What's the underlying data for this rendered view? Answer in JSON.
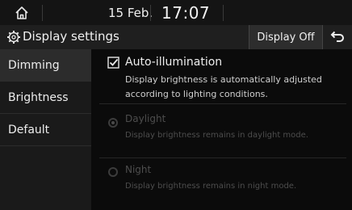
{
  "status_bar": {
    "date": "15 Feb.",
    "time": "17:07"
  },
  "header": {
    "title": "Display settings",
    "display_off_label": "Display Off"
  },
  "sidebar": {
    "items": [
      {
        "label": "Dimming",
        "active": true
      },
      {
        "label": "Brightness",
        "active": false
      },
      {
        "label": "Default",
        "active": false
      }
    ]
  },
  "content": {
    "auto_illumination": {
      "label": "Auto-illumination",
      "checked": true,
      "description_line1": "Display brightness is automatically adjusted",
      "description_line2": "according to lighting conditions."
    },
    "daylight": {
      "label": "Daylight",
      "selected": true,
      "enabled": false,
      "description": "Display brightness remains in daylight mode."
    },
    "night": {
      "label": "Night",
      "selected": false,
      "enabled": false,
      "description": "Display brightness remains in night mode."
    }
  },
  "colors": {
    "background": "#0b0b0b",
    "header": "#1f1f1f",
    "sidebar": "#1a1a1a",
    "active_item": "#2c2c2c",
    "text": "#e6e6e6",
    "disabled_text": "#4d4d4d"
  },
  "icons": {
    "home": "home-icon",
    "gear": "gear-icon",
    "back": "back-arrow-icon",
    "checkbox": "checkbox-checked-icon"
  }
}
